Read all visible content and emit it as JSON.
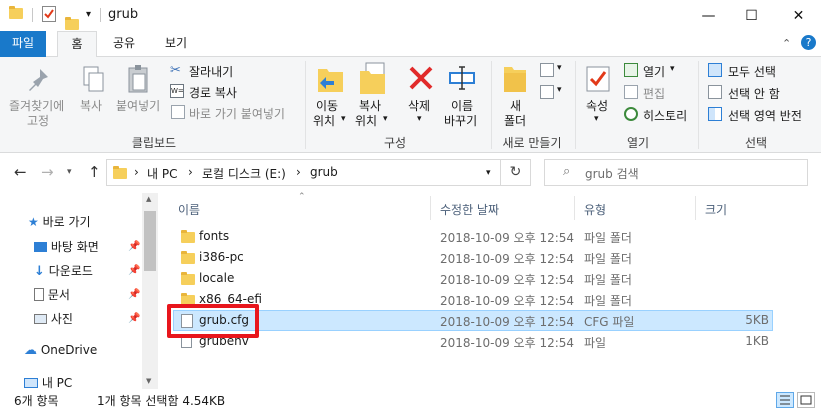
{
  "window": {
    "title": "grub",
    "minimize": "—",
    "maximize": "☐",
    "close": "✕"
  },
  "tabs": [
    "파일",
    "홈",
    "공유",
    "보기"
  ],
  "ribbon": {
    "clipboard": {
      "pin_label_1": "즐겨찾기에",
      "pin_label_2": "고정",
      "copy": "복사",
      "paste": "붙여넣기",
      "cut": "잘라내기",
      "copy_path": "경로 복사",
      "paste_shortcut": "바로 가기 붙여넣기",
      "group": "클립보드"
    },
    "organize": {
      "move_1": "이동",
      "move_2": "위치",
      "copy_1": "복사",
      "copy_2": "위치",
      "delete": "삭제",
      "rename_1": "이름",
      "rename_2": "바꾸기",
      "group": "구성"
    },
    "new": {
      "new_folder_1": "새",
      "new_folder_2": "폴더",
      "group": "새로 만들기"
    },
    "open": {
      "properties": "속성",
      "open": "열기",
      "edit": "편집",
      "history": "히스토리",
      "group": "열기"
    },
    "select": {
      "select_all": "모두 선택",
      "select_none": "선택 안 함",
      "invert": "선택 영역 반전",
      "group": "선택"
    }
  },
  "address": {
    "crumbs": [
      "내 PC",
      "로컬 디스크 (E:)",
      "grub"
    ],
    "search_placeholder": "grub 검색"
  },
  "nav": {
    "quick_access": "바로 가기",
    "items": [
      "바탕 화면",
      "다운로드",
      "문서",
      "사진"
    ],
    "onedrive": "OneDrive",
    "this_pc": "내 PC"
  },
  "columns": [
    "이름",
    "수정한 날짜",
    "유형",
    "크기"
  ],
  "files": [
    {
      "name": "fonts",
      "date": "2018-10-09 오후 12:54",
      "type": "파일 폴더",
      "size": ""
    },
    {
      "name": "i386-pc",
      "date": "2018-10-09 오후 12:54",
      "type": "파일 폴더",
      "size": ""
    },
    {
      "name": "locale",
      "date": "2018-10-09 오후 12:54",
      "type": "파일 폴더",
      "size": ""
    },
    {
      "name": "x86_64-efi",
      "date": "2018-10-09 오후 12:54",
      "type": "파일 폴더",
      "size": ""
    },
    {
      "name": "grub.cfg",
      "date": "2018-10-09 오후 12:54",
      "type": "CFG 파일",
      "size": "5KB"
    },
    {
      "name": "grubenv",
      "date": "2018-10-09 오후 12:54",
      "type": "파일",
      "size": "1KB"
    }
  ],
  "status": {
    "count": "6개 항목",
    "selection": "1개 항목 선택함 4.54KB"
  }
}
